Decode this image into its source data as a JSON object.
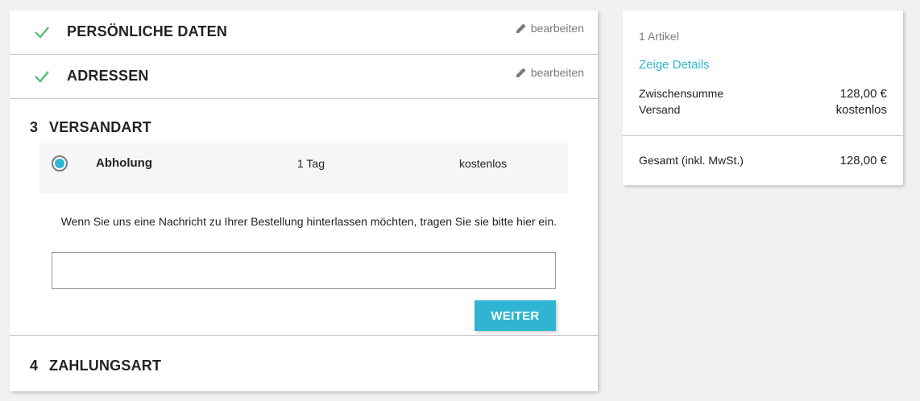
{
  "steps": {
    "personal": {
      "title": "PERSÖNLICHE DATEN",
      "edit_label": "bearbeiten"
    },
    "addresses": {
      "title": "ADRESSEN",
      "edit_label": "bearbeiten"
    },
    "shipping": {
      "number": "3",
      "title": "VERSANDART",
      "carrier": {
        "name": "Abholung",
        "delay": "1 Tag",
        "price": "kostenlos"
      },
      "message_label": "Wenn Sie uns eine Nachricht zu Ihrer Bestellung hinterlassen möchten, tragen Sie sie bitte hier ein.",
      "message_value": "",
      "continue_label": "WEITER"
    },
    "payment": {
      "number": "4",
      "title": "ZAHLUNGSART"
    }
  },
  "summary": {
    "item_count": "1 Artikel",
    "show_details": "Zeige Details",
    "subtotal_label": "Zwischensumme",
    "subtotal_value": "128,00 €",
    "shipping_label": "Versand",
    "shipping_value": "kostenlos",
    "total_label": "Gesamt (inkl. MwSt.)",
    "total_value": "128,00 €"
  },
  "colors": {
    "accent": "#2fb5d2",
    "check": "#4cbb6c",
    "background": "#f1f1f1"
  },
  "icons": {
    "done": "check-icon",
    "edit": "pencil-icon",
    "selected": "radio-selected-icon"
  }
}
